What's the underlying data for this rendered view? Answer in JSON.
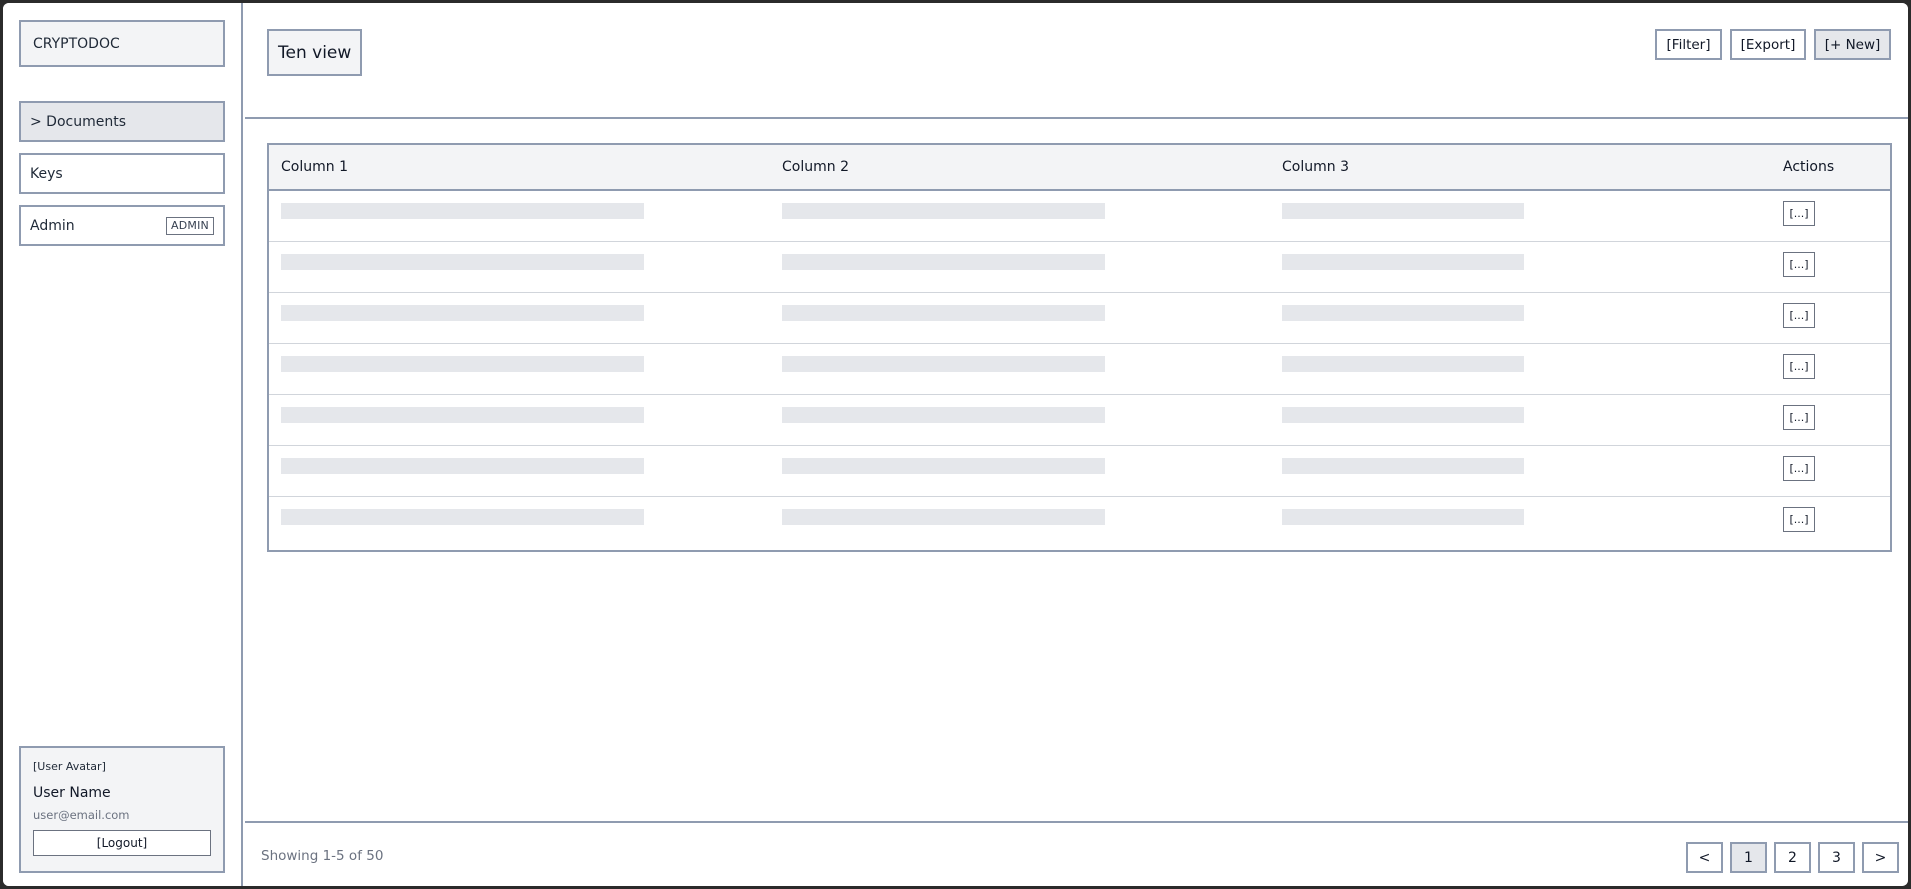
{
  "sidebar": {
    "logo": "CRYPTODOC",
    "items": [
      {
        "label": "> Documents",
        "active": true
      },
      {
        "label": "Keys",
        "active": false
      },
      {
        "label": "Admin",
        "active": false,
        "badge": "ADMIN"
      }
    ],
    "user": {
      "avatar": "[User Avatar]",
      "name": "User Name",
      "email": "user@email.com",
      "logout_label": "[Logout]"
    }
  },
  "header": {
    "title": "Ten view",
    "buttons": {
      "filter": "[Filter]",
      "export": "[Export]",
      "new": "[+ New]"
    }
  },
  "table": {
    "columns": [
      "Column 1",
      "Column 2",
      "Column 3",
      "Actions"
    ],
    "row_action_label": "[...]",
    "row_count": 7
  },
  "footer": {
    "showing": "Showing 1-5 of 50",
    "pagination": {
      "prev": "<",
      "pages": [
        "1",
        "2",
        "3"
      ],
      "active_page": "1",
      "next": ">"
    }
  },
  "colors": {
    "border": "#8f9bb0",
    "panel_bg": "#f3f4f6",
    "active_bg": "#e5e7eb",
    "skeleton": "#e5e7eb",
    "muted_text": "#6b7280"
  }
}
